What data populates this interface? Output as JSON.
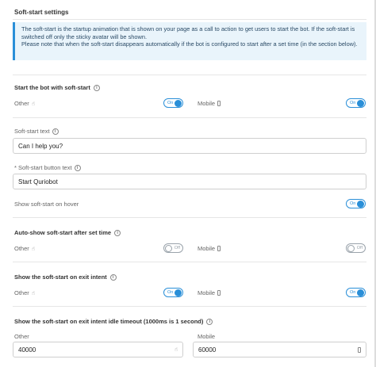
{
  "panel": {
    "title": "Soft-start settings"
  },
  "info": {
    "line1": "The soft-start is the startup animation that is shown on your page as a call to action to get users to start the bot. If the soft-start is switched off only the sticky avatar will be shown.",
    "line2": "Please note that when the soft-start disappears automatically if the bot is configured to start after a set time (in the section below)."
  },
  "start_with_softstart": {
    "title": "Start the bot with soft-start",
    "other_label": "Other",
    "other_toggle": "On",
    "mobile_label": "Mobile",
    "mobile_toggle": "On"
  },
  "softstart_text": {
    "label": "Soft-start text",
    "value": "Can I help you?"
  },
  "softstart_button_text": {
    "label": "* Soft-start button text",
    "value": "Start Quriobot"
  },
  "show_on_hover": {
    "label": "Show soft-start on hover",
    "toggle": "On"
  },
  "auto_show": {
    "title": "Auto-show soft-start after set time",
    "other_label": "Other",
    "other_toggle": "Off",
    "mobile_label": "Mobile",
    "mobile_toggle": "Off"
  },
  "exit_intent": {
    "title": "Show the soft-start on exit intent",
    "other_label": "Other",
    "other_toggle": "On",
    "mobile_label": "Mobile",
    "mobile_toggle": "On"
  },
  "exit_idle": {
    "title": "Show the soft-start on exit intent idle timeout (1000ms is 1 second)",
    "other_label": "Other",
    "other_value": "40000",
    "mobile_label": "Mobile",
    "mobile_value": "60000"
  },
  "icons": {
    "info": "info-icon",
    "other": "pointer-icon",
    "mobile": "mobile-icon"
  },
  "colors": {
    "accent": "#2a8fd8",
    "info_bg": "#e9f4fb"
  }
}
